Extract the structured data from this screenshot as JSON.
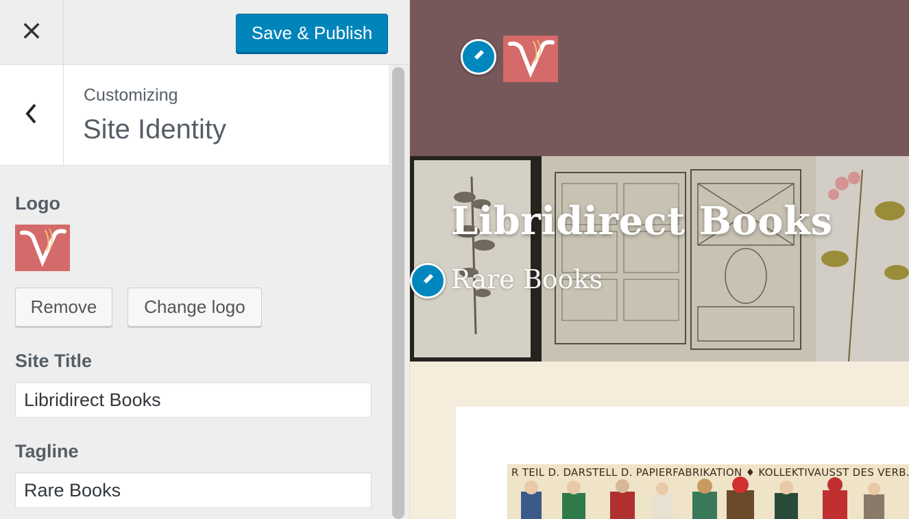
{
  "app": {
    "close_label": "Close",
    "save_publish_label": "Save & Publish",
    "back_label": "Back"
  },
  "section": {
    "customizing_label": "Customizing",
    "title": "Site Identity"
  },
  "logo": {
    "label": "Logo",
    "remove_label": "Remove",
    "change_label": "Change logo"
  },
  "site_title": {
    "label": "Site Title",
    "value": "Libridirect Books"
  },
  "tagline": {
    "label": "Tagline",
    "value": "Rare Books"
  },
  "preview": {
    "site_title": "Libridirect Books",
    "tagline": "Rare Books",
    "tapestry_caption": "R TEIL D. DARSTELL D. PAPIERFABRIKATION ♦ KOLLEKTIVAUSST DES VERB. SCHWEIZ."
  },
  "colors": {
    "primary_button": "#0085ba",
    "header_bg": "#76585a",
    "logo_bg": "#d46a6a",
    "preview_bg": "#f6ecdc",
    "edit_shortcut": "#0087be"
  },
  "icons": {
    "close": "close-icon",
    "back": "chevron-left-icon",
    "edit": "pencil-icon"
  }
}
